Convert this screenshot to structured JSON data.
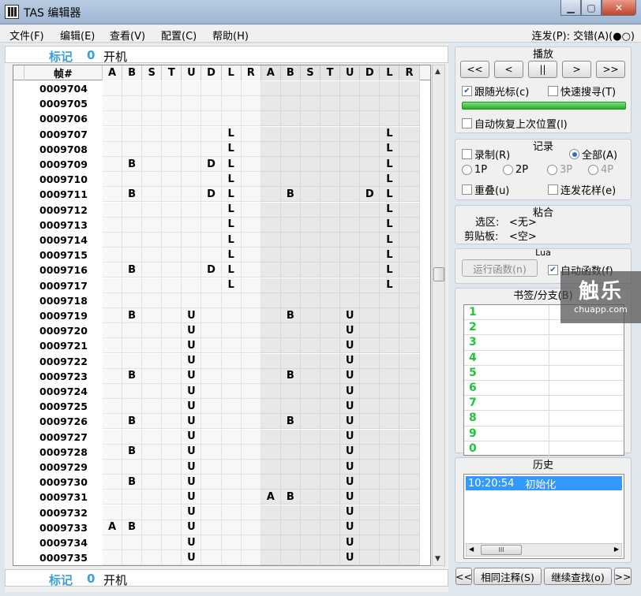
{
  "window": {
    "title": "TAS 编辑器"
  },
  "menu": {
    "items": [
      "文件(F)",
      "编辑(E)",
      "查看(V)",
      "配置(C)",
      "帮助(H)"
    ],
    "autofire": "连发(P): 交错(A)(●○)"
  },
  "marker": {
    "label": "标记",
    "number": "0",
    "text": "开机"
  },
  "grid": {
    "frame_header": "帧#",
    "buttons": [
      "A",
      "B",
      "S",
      "T",
      "U",
      "D",
      "L",
      "R",
      "A",
      "B",
      "S",
      "T",
      "U",
      "D",
      "L",
      "R"
    ],
    "rows": [
      {
        "frame": "0009704",
        "inputs": ""
      },
      {
        "frame": "0009705",
        "inputs": ""
      },
      {
        "frame": "0009706",
        "inputs": ""
      },
      {
        "frame": "0009707",
        "inputs": "6,14"
      },
      {
        "frame": "0009708",
        "inputs": "6,14"
      },
      {
        "frame": "0009709",
        "inputs": "1,5,6,14"
      },
      {
        "frame": "0009710",
        "inputs": "6,14"
      },
      {
        "frame": "0009711",
        "inputs": "1,5,6,9,13,14"
      },
      {
        "frame": "0009712",
        "inputs": "6,14"
      },
      {
        "frame": "0009713",
        "inputs": "6,14"
      },
      {
        "frame": "0009714",
        "inputs": "6,14"
      },
      {
        "frame": "0009715",
        "inputs": "6,14"
      },
      {
        "frame": "0009716",
        "inputs": "1,5,6,14"
      },
      {
        "frame": "0009717",
        "inputs": "6,14"
      },
      {
        "frame": "0009718",
        "inputs": ""
      },
      {
        "frame": "0009719",
        "inputs": "1,4,9,12"
      },
      {
        "frame": "0009720",
        "inputs": "4,12"
      },
      {
        "frame": "0009721",
        "inputs": "4,12"
      },
      {
        "frame": "0009722",
        "inputs": "4,12"
      },
      {
        "frame": "0009723",
        "inputs": "1,4,9,12"
      },
      {
        "frame": "0009724",
        "inputs": "4,12"
      },
      {
        "frame": "0009725",
        "inputs": "4,12"
      },
      {
        "frame": "0009726",
        "inputs": "1,4,9,12"
      },
      {
        "frame": "0009727",
        "inputs": "4,12"
      },
      {
        "frame": "0009728",
        "inputs": "1,4,12"
      },
      {
        "frame": "0009729",
        "inputs": "4,12"
      },
      {
        "frame": "0009730",
        "inputs": "1,4,12"
      },
      {
        "frame": "0009731",
        "inputs": "4,8,9,12"
      },
      {
        "frame": "0009732",
        "inputs": "4,12"
      },
      {
        "frame": "0009733",
        "inputs": "0,1,4,12"
      },
      {
        "frame": "0009734",
        "inputs": "4,12"
      },
      {
        "frame": "0009735",
        "inputs": "4,12"
      }
    ]
  },
  "playback": {
    "title": "播放",
    "buttons": [
      "<<",
      "<",
      "||",
      ">",
      ">>"
    ],
    "follow_cursor": "跟随光标(c)",
    "turbo_seek": "快速搜寻(T)",
    "progress": 1.0,
    "restore_position": "自动恢复上次位置(l)"
  },
  "recording": {
    "title": "记录",
    "record": "录制(R)",
    "all": "全部(A)",
    "p1": "1P",
    "p2": "2P",
    "p3": "3P",
    "p4": "4P",
    "superimpose": "重叠(u)",
    "turbo_pattern": "连发花样(e)"
  },
  "clipboard": {
    "title": "粘合",
    "selection_label": "选区:",
    "selection_value": "<无>",
    "clipboard_label": "剪贴板:",
    "clipboard_value": "<空>"
  },
  "lua": {
    "title": "Lua",
    "run_button": "运行函数(n)",
    "auto_function": "自动函数(f)"
  },
  "bookmarks": {
    "title": "书签/分支(B)",
    "items": [
      "1",
      "2",
      "3",
      "4",
      "5",
      "6",
      "7",
      "8",
      "9",
      "0"
    ]
  },
  "history": {
    "title": "历史",
    "entries": [
      {
        "time": "10:20:54",
        "text": "初始化"
      }
    ],
    "thumb_label": "III"
  },
  "bottom_nav": {
    "prev": "<<",
    "similar": "相同注释(S)",
    "more": "继续查找(o)",
    "next": ">>"
  },
  "watermark": {
    "big": "触乐",
    "small": "chuapp.com"
  }
}
